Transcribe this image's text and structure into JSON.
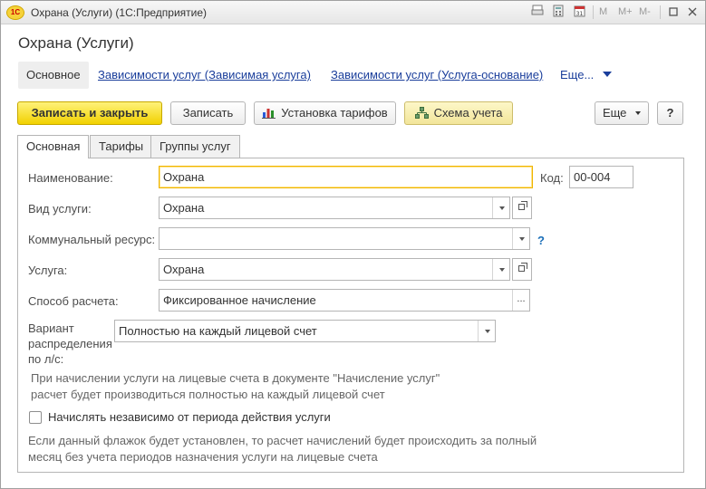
{
  "window": {
    "logo_text": "1C",
    "title": "Охрана (Услуги)  (1С:Предприятие)",
    "m_labels": [
      "M",
      "M+",
      "M-"
    ]
  },
  "form": {
    "title": "Охрана (Услуги)"
  },
  "nav": {
    "main": "Основное",
    "links": [
      "Зависимости услуг (Зависимая услуга)",
      "Зависимости услуг (Услуга-основание)"
    ],
    "more": "Еще..."
  },
  "toolbar": {
    "save_close": "Записать и закрыть",
    "save": "Записать",
    "tariffs": "Установка тарифов",
    "scheme": "Схема учета",
    "more": "Еще",
    "help": "?"
  },
  "tabs": [
    "Основная",
    "Тарифы",
    "Группы услуг"
  ],
  "fields": {
    "name_label": "Наименование:",
    "name_value": "Охрана",
    "code_label": "Код:",
    "code_value": "00-004",
    "service_type_label": "Вид услуги:",
    "service_type_value": "Охрана",
    "utility_label": "Коммунальный ресурс:",
    "utility_value": "",
    "utility_help": "?",
    "service_label": "Услуга:",
    "service_value": "Охрана",
    "calc_label": "Способ расчета:",
    "calc_value": "Фиксированное начисление",
    "dist_label_1": "Вариант",
    "dist_label_2": "распределения",
    "dist_label_3": "по л/с:",
    "dist_value": "Полностью на каждый лицевой счет"
  },
  "notes": {
    "dist_note_1": "При начислении услуги на лицевые счета в документе \"Начисление услуг\"",
    "dist_note_2": "расчет будет производиться полностью на каждый лицевой счет",
    "checkbox_label": "Начислять независимо от периода действия услуги",
    "checkbox_checked": false,
    "check_note_1": "Если данный флажок будет установлен, то расчет начислений будет происходить за полный",
    "check_note_2": "месяц без учета периодов назначения услуги на лицевые счета"
  }
}
